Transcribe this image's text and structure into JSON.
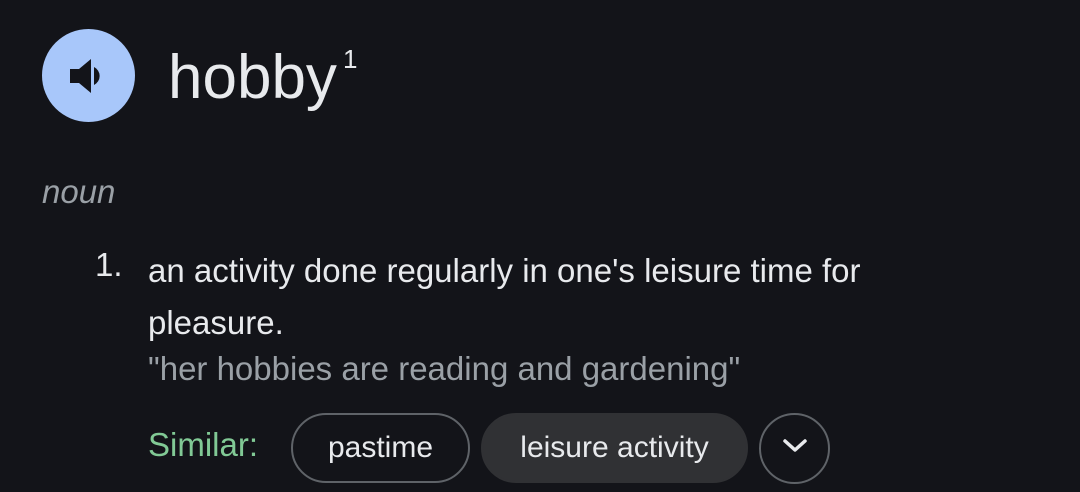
{
  "entry": {
    "word": "hobby",
    "homograph_number": "1",
    "part_of_speech": "noun",
    "pronunciation_icon": "speaker-icon"
  },
  "senses": [
    {
      "number": "1.",
      "definition": "an activity done regularly in one's leisure time for pleasure.",
      "example": "\"her hobbies are reading and gardening\""
    }
  ],
  "similar": {
    "label": "Similar:",
    "chips": [
      "pastime",
      "leisure activity"
    ],
    "expand_icon": "chevron-down-icon"
  },
  "colors": {
    "background": "#131419",
    "primary_text": "#e8eaed",
    "secondary_text": "#9aa0a6",
    "similar_label": "#81c995",
    "speaker_button": "#a8c7fa",
    "chip_border": "#5f6368",
    "chip_filled": "#303134"
  }
}
